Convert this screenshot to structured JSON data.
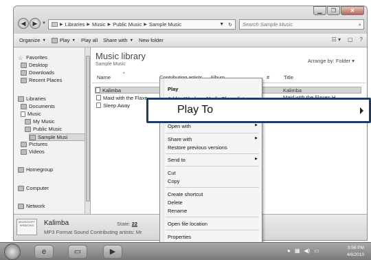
{
  "window": {
    "controls": {
      "minimize": "▁",
      "maximize": "❐",
      "close": "✕"
    }
  },
  "address_bar": {
    "segments": [
      "Libraries",
      "Music",
      "Public Music",
      "Sample Music"
    ],
    "refresh": "↻"
  },
  "search": {
    "placeholder": "Search Sample Music",
    "icon": "search-icon"
  },
  "toolbar": {
    "organize": "Organize",
    "play": "Play",
    "play_all": "Play all",
    "share_with": "Share with",
    "new_folder": "New folder"
  },
  "nav": {
    "favorites": "Favorites",
    "desktop": "Desktop",
    "downloads": "Downloads",
    "recent_places": "Recent Places",
    "libraries": "Libraries",
    "documents": "Documents",
    "music": "Music",
    "my_music": "My Music",
    "public_music": "Public Music",
    "sample_music": "Sample Musi",
    "pictures": "Pictures",
    "videos": "Videos",
    "homegroup": "Homegroup",
    "computer": "Computer",
    "network": "Network"
  },
  "library": {
    "title": "Music library",
    "subtitle": "Sample Music",
    "arrange_label": "Arrange by:",
    "arrange_value": "Folder"
  },
  "columns": {
    "name": "Name",
    "artists": "Contributing artists",
    "album": "Album",
    "number": "#",
    "title": "Title"
  },
  "files": [
    {
      "name": "Kalimba",
      "title": "Kalimba"
    },
    {
      "name": "Maid with the Flaxe...",
      "title": "Maid with the Flaxen H..."
    },
    {
      "name": "Sleep Away",
      "title": ""
    }
  ],
  "context_menu": {
    "play": "Play",
    "add_to_playlist": "Add to Windows Media Player list",
    "play_to": "Play To",
    "open_with": "Open with",
    "share_with": "Share with",
    "restore": "Restore previous versions",
    "send_to": "Send to",
    "cut": "Cut",
    "copy": "Copy",
    "create_shortcut": "Create shortcut",
    "delete": "Delete",
    "rename": "Rename",
    "open_location": "Open file location",
    "properties": "Properties"
  },
  "details": {
    "thumb_text": "MICROSOFT WINDOWS",
    "name": "Kalimba",
    "type": "MP3 Format Sound",
    "artists_label": "Contributing artists:",
    "artists_value": "Mr",
    "state_label": "State:",
    "state_value": "22"
  },
  "taskbar": {
    "time": "3:56 PM",
    "date": "4/6/2010"
  }
}
